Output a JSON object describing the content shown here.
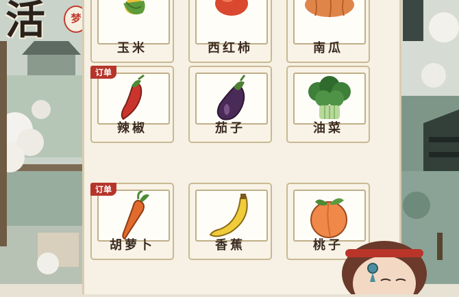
{
  "game": {
    "title_glyph": "活",
    "title_seal": "梦"
  },
  "inventory": {
    "rows": [
      {
        "items": [
          {
            "label": "玉米",
            "icon": "corn-icon",
            "tag": ""
          },
          {
            "label": "西红柿",
            "icon": "tomato-icon",
            "tag": ""
          },
          {
            "label": "南瓜",
            "icon": "pumpkin-icon",
            "tag": ""
          }
        ]
      },
      {
        "items": [
          {
            "label": "辣椒",
            "icon": "chili-pepper-icon",
            "tag": "订单"
          },
          {
            "label": "茄子",
            "icon": "eggplant-icon",
            "tag": ""
          },
          {
            "label": "油菜",
            "icon": "rapeseed-greens-icon",
            "tag": ""
          }
        ]
      },
      {
        "items": [
          {
            "label": "胡萝卜",
            "icon": "carrot-icon",
            "tag": "订单"
          },
          {
            "label": "香蕉",
            "icon": "banana-icon",
            "tag": ""
          },
          {
            "label": "桃子",
            "icon": "peach-icon",
            "tag": ""
          }
        ]
      }
    ]
  },
  "colors": {
    "order_tag": "#b6352b",
    "card_border": "#c9b892",
    "panel_bg": "#f6f1e4"
  }
}
